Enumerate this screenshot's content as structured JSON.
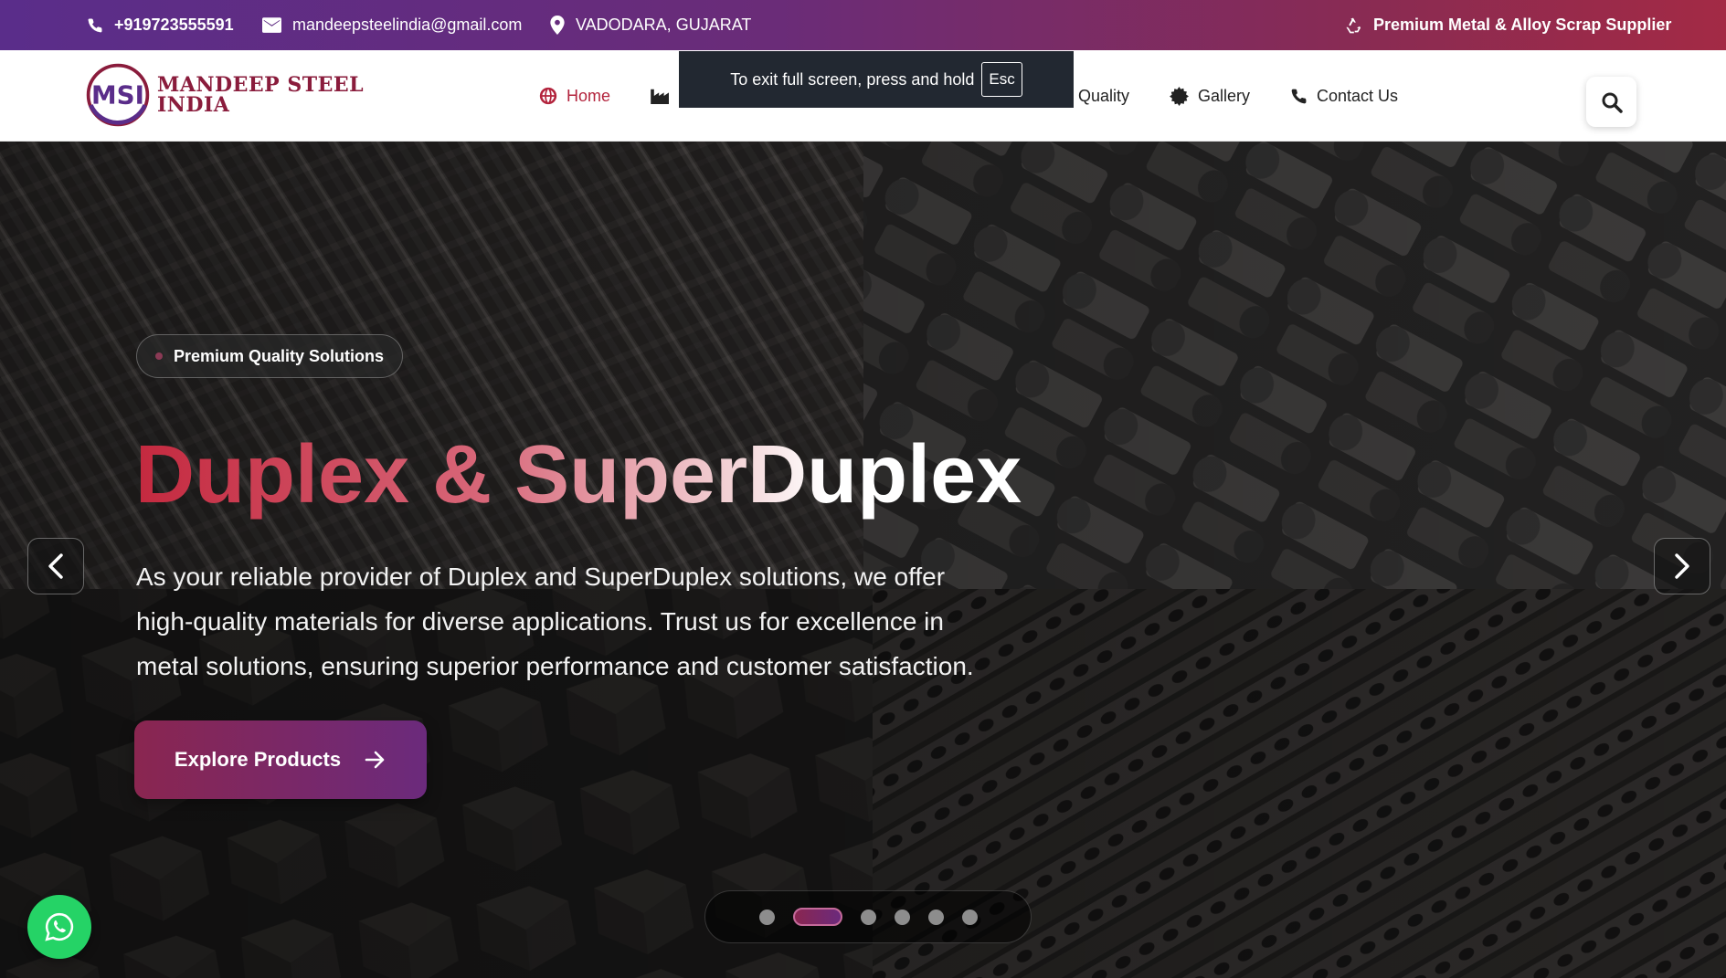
{
  "topbar": {
    "phone": "+919723555591",
    "email": "mandeepsteelindia@gmail.com",
    "location": "VADODARA, GUJARAT",
    "tagline": "Premium Metal & Alloy Scrap Supplier"
  },
  "logo": {
    "monogram": "MSI",
    "line1": "MANDEEP STEEL",
    "line2": "INDIA"
  },
  "nav": {
    "home": "Home",
    "quality": "Quality",
    "gallery": "Gallery",
    "contact": "Contact Us"
  },
  "fullscreen_toast": {
    "message": "To exit full screen, press and hold",
    "key": "Esc"
  },
  "hero": {
    "badge": "Premium Quality Solutions",
    "title": "Duplex & SuperDuplex",
    "description": "As your reliable provider of Duplex and SuperDuplex solutions, we offer high-quality materials for diverse applications. Trust us for excellence in metal solutions, ensuring superior performance and customer satisfaction.",
    "cta_label": "Explore Products",
    "slides_total": 6,
    "active_slide": 2
  },
  "colors": {
    "accent_red": "#b3243d",
    "accent_purple": "#6b2a7c",
    "whatsapp_green": "#25d366"
  }
}
